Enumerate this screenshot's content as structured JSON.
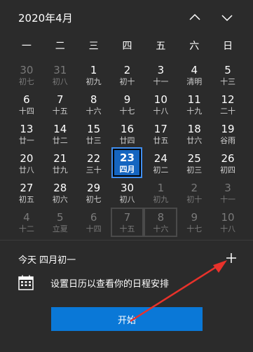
{
  "header": {
    "title": "2020年4月"
  },
  "weekdays": [
    "一",
    "二",
    "三",
    "四",
    "五",
    "六",
    "日"
  ],
  "days": [
    {
      "num": "30",
      "lunar": "初七",
      "dim": true
    },
    {
      "num": "31",
      "lunar": "初八",
      "dim": true
    },
    {
      "num": "1",
      "lunar": "初九",
      "dim": false
    },
    {
      "num": "2",
      "lunar": "初十",
      "dim": false
    },
    {
      "num": "3",
      "lunar": "十一",
      "dim": false
    },
    {
      "num": "4",
      "lunar": "清明",
      "dim": false
    },
    {
      "num": "5",
      "lunar": "十三",
      "dim": false
    },
    {
      "num": "6",
      "lunar": "十四",
      "dim": false
    },
    {
      "num": "7",
      "lunar": "十五",
      "dim": false
    },
    {
      "num": "8",
      "lunar": "十六",
      "dim": false
    },
    {
      "num": "9",
      "lunar": "十七",
      "dim": false
    },
    {
      "num": "10",
      "lunar": "十八",
      "dim": false
    },
    {
      "num": "11",
      "lunar": "十九",
      "dim": false
    },
    {
      "num": "12",
      "lunar": "二十",
      "dim": false
    },
    {
      "num": "13",
      "lunar": "廿一",
      "dim": false
    },
    {
      "num": "14",
      "lunar": "廿二",
      "dim": false
    },
    {
      "num": "15",
      "lunar": "廿三",
      "dim": false
    },
    {
      "num": "16",
      "lunar": "廿四",
      "dim": false
    },
    {
      "num": "17",
      "lunar": "廿五",
      "dim": false
    },
    {
      "num": "18",
      "lunar": "廿六",
      "dim": false
    },
    {
      "num": "19",
      "lunar": "谷雨",
      "dim": false
    },
    {
      "num": "20",
      "lunar": "廿八",
      "dim": false
    },
    {
      "num": "21",
      "lunar": "廿九",
      "dim": false
    },
    {
      "num": "22",
      "lunar": "三十",
      "dim": false
    },
    {
      "num": "23",
      "lunar": "四月",
      "dim": false,
      "today": true
    },
    {
      "num": "24",
      "lunar": "初二",
      "dim": false
    },
    {
      "num": "25",
      "lunar": "初三",
      "dim": false
    },
    {
      "num": "26",
      "lunar": "初四",
      "dim": false
    },
    {
      "num": "27",
      "lunar": "初五",
      "dim": false
    },
    {
      "num": "28",
      "lunar": "初六",
      "dim": false
    },
    {
      "num": "29",
      "lunar": "初七",
      "dim": false
    },
    {
      "num": "30",
      "lunar": "初八",
      "dim": false
    },
    {
      "num": "1",
      "lunar": "初九",
      "dim": true
    },
    {
      "num": "2",
      "lunar": "初十",
      "dim": true
    },
    {
      "num": "3",
      "lunar": "十一",
      "dim": true
    },
    {
      "num": "4",
      "lunar": "十二",
      "dim": true
    },
    {
      "num": "5",
      "lunar": "立夏",
      "dim": true
    },
    {
      "num": "6",
      "lunar": "十四",
      "dim": true
    },
    {
      "num": "7",
      "lunar": "十五",
      "dim": true,
      "boxed": true
    },
    {
      "num": "8",
      "lunar": "十六",
      "dim": true,
      "boxed": true
    },
    {
      "num": "9",
      "lunar": "十七",
      "dim": true
    },
    {
      "num": "10",
      "lunar": "十八",
      "dim": true
    }
  ],
  "agenda": {
    "title": "今天 四月初一",
    "message": "设置日历以查看你的日程安排",
    "start_label": "开始"
  },
  "colors": {
    "accent": "#0a78d7",
    "today_bg": "#1565c0",
    "annotation": "#e8322b"
  }
}
